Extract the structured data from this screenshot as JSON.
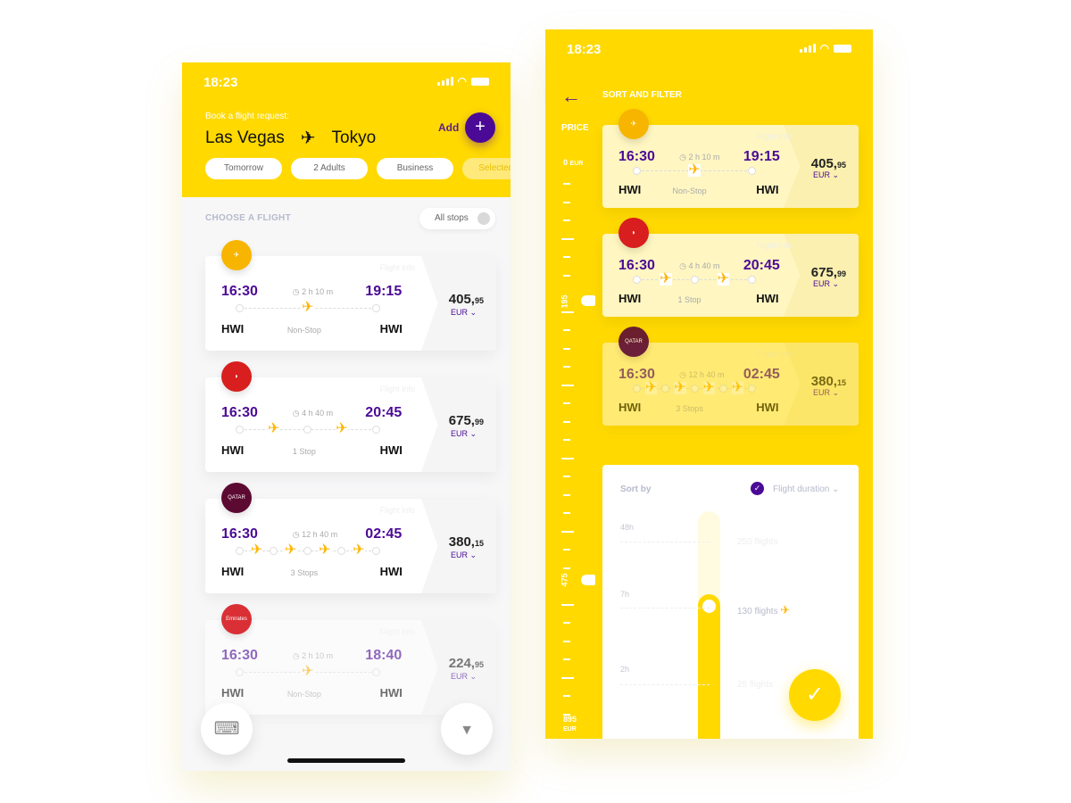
{
  "colors": {
    "accent": "#ffd900",
    "brand": "#4b0a96"
  },
  "status": {
    "time": "18:23"
  },
  "main": {
    "subtitle": "Book a flight request:",
    "from": "Las Vegas",
    "to": "Tokyo",
    "route_icon": "airplane-icon",
    "add_label": "Add",
    "add_icon": "+",
    "chips": [
      "Tomorrow",
      "2 Adults",
      "Business",
      "Selected ai"
    ],
    "choose_label": "CHOOSE A FLIGHT",
    "stops_toggle": "All stops",
    "flights": [
      {
        "airline": "Lufthansa",
        "logo_color": "#f7b500",
        "logo_text": "✈",
        "info": "Flight Info",
        "dep": "16:30",
        "arr": "19:15",
        "dep_code": "HWI",
        "arr_code": "HWI",
        "duration": "2 h 10 m",
        "stops": 0,
        "stops_label": "Non-Stop",
        "price": "405,",
        "cents": "95",
        "currency": "EUR ⌄"
      },
      {
        "airline": "Turkish Airlines",
        "logo_color": "#d81e1e",
        "logo_text": "◗",
        "info": "Flight Info",
        "dep": "16:30",
        "arr": "20:45",
        "dep_code": "HWI",
        "arr_code": "HWI",
        "duration": "4 h 40 m",
        "stops": 1,
        "stops_label": "1 Stop",
        "price": "675,",
        "cents": "99",
        "currency": "EUR ⌄"
      },
      {
        "airline": "Qatar",
        "logo_color": "#5c0a32",
        "logo_text": "QATAR",
        "info": "Flight Info",
        "dep": "16:30",
        "arr": "02:45",
        "dep_code": "HWI",
        "arr_code": "HWI",
        "duration": "12 h 40 m",
        "stops": 3,
        "stops_label": "3 Stops",
        "price": "380,",
        "cents": "15",
        "currency": "EUR ⌄"
      },
      {
        "airline": "Emirates",
        "logo_color": "#d71a21",
        "logo_text": "Emirates",
        "info": "Flight Info",
        "dep": "16:30",
        "arr": "18:40",
        "dep_code": "HWI",
        "arr_code": "HWI",
        "duration": "2 h 10 m",
        "stops": 0,
        "stops_label": "Non-Stop",
        "price": "224,",
        "cents": "95",
        "currency": "EUR ⌄"
      }
    ],
    "keyboard_icon": "⌨",
    "filter_icon": "▼"
  },
  "filter": {
    "back_icon": "←",
    "title": "SORT AND FILTER",
    "price_label": "PRICE",
    "rail_min": "0",
    "rail_min_unit": "EUR",
    "rail_low": "195",
    "rail_high": "475",
    "rail_max": "895",
    "rail_max_unit": "EUR",
    "sort_label": "Sort by",
    "sort_check": "✓",
    "sort_value": "Flight duration ⌄",
    "durations": [
      {
        "label": "48h",
        "count": "250 flights"
      },
      {
        "label": "7h",
        "count": "130 flights"
      },
      {
        "label": "2h",
        "count": "25 flights"
      }
    ],
    "selected_duration": "7h",
    "confirm_icon": "✓"
  }
}
